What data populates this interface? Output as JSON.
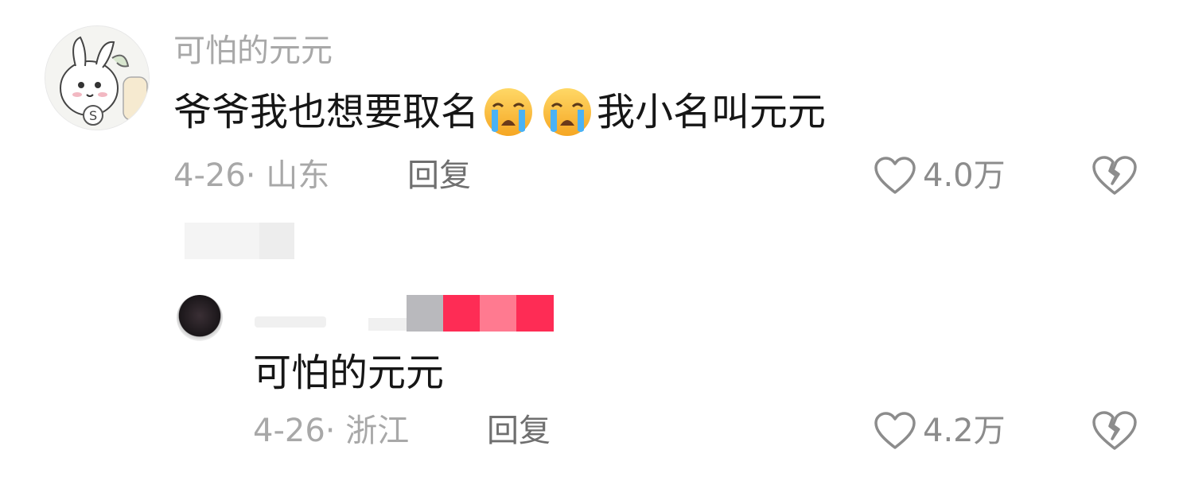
{
  "comments": [
    {
      "username": "可怕的元元",
      "text_part1": "爷爷我也想要取名",
      "text_part2": "我小名叫元元",
      "emoji": "loudly-crying-face",
      "date_location": "4-26· 山东",
      "reply_label": "回复",
      "likes": "4.0万"
    },
    {
      "text": "可怕的元元",
      "date_location": "4-26· 浙江",
      "reply_label": "回复",
      "likes": "4.2万"
    }
  ],
  "colors": {
    "username": "#a8a8a8",
    "meta": "#a8a8a8",
    "reply": "#6f6f6f",
    "pixel_red": "#fe2c55",
    "pixel_pink": "#ff7a90",
    "pixel_gray": "#b9b9bd"
  }
}
